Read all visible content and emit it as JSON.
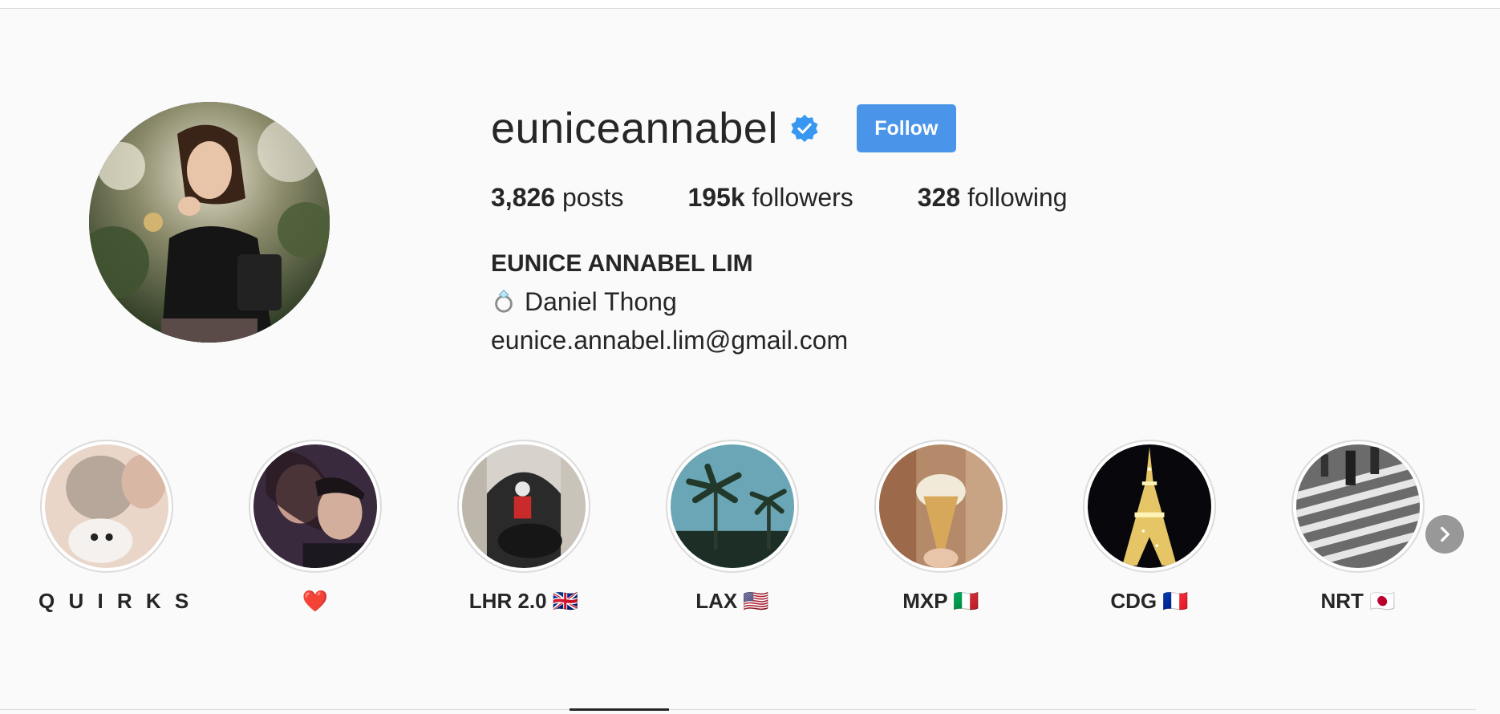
{
  "profile": {
    "username": "euniceannabel",
    "verified_icon": "verified-badge-icon",
    "follow_label": "Follow",
    "stats": {
      "posts_count": "3,826",
      "posts_label": "posts",
      "followers_count": "195k",
      "followers_label": "followers",
      "following_count": "328",
      "following_label": "following"
    },
    "full_name": "EUNICE ANNABEL LIM",
    "bio": {
      "line1": "Daniel Thong",
      "line1_icon": "ring-icon",
      "line2": "eunice.annabel.lim@gmail.com"
    }
  },
  "highlights": [
    {
      "label": "Q U I R K S"
    },
    {
      "label": "❤️"
    },
    {
      "label": "LHR 2.0 🇬🇧"
    },
    {
      "label": "LAX 🇺🇸"
    },
    {
      "label": "MXP 🇮🇹"
    },
    {
      "label": "CDG 🇫🇷"
    },
    {
      "label": "NRT 🇯🇵"
    }
  ],
  "colors": {
    "accent": "#4a95e9",
    "background": "#fafafa",
    "text": "#262626",
    "border": "#dbdbdb"
  }
}
